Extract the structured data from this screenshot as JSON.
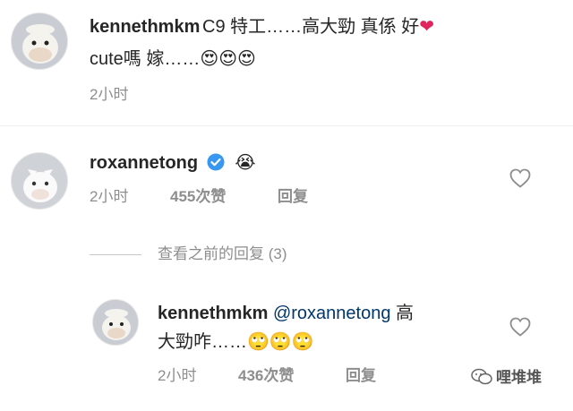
{
  "comments": [
    {
      "username": "kennethmkm",
      "text_line1": "C9 特工……高大勁 真係 好",
      "text_line2": "cute嗎 嫁……",
      "time": "2小时"
    },
    {
      "username": "roxannetong",
      "verified": true,
      "time": "2小时",
      "likes": "455次赞",
      "reply_label": "回复"
    }
  ],
  "view_previous_replies": "查看之前的回复 (3)",
  "reply": {
    "username": "kennethmkm",
    "mention": "@roxannetong",
    "text_line1_rest": "高",
    "text_line2": "大勁咋……",
    "time": "2小时",
    "likes": "436次赞",
    "reply_label": "回复"
  },
  "watermark": "哩堆堆",
  "colors": {
    "mention": "#00376b",
    "verified_badge": "#3897f0",
    "muted": "#8e8e8e",
    "heart_red": "#e0245e"
  }
}
